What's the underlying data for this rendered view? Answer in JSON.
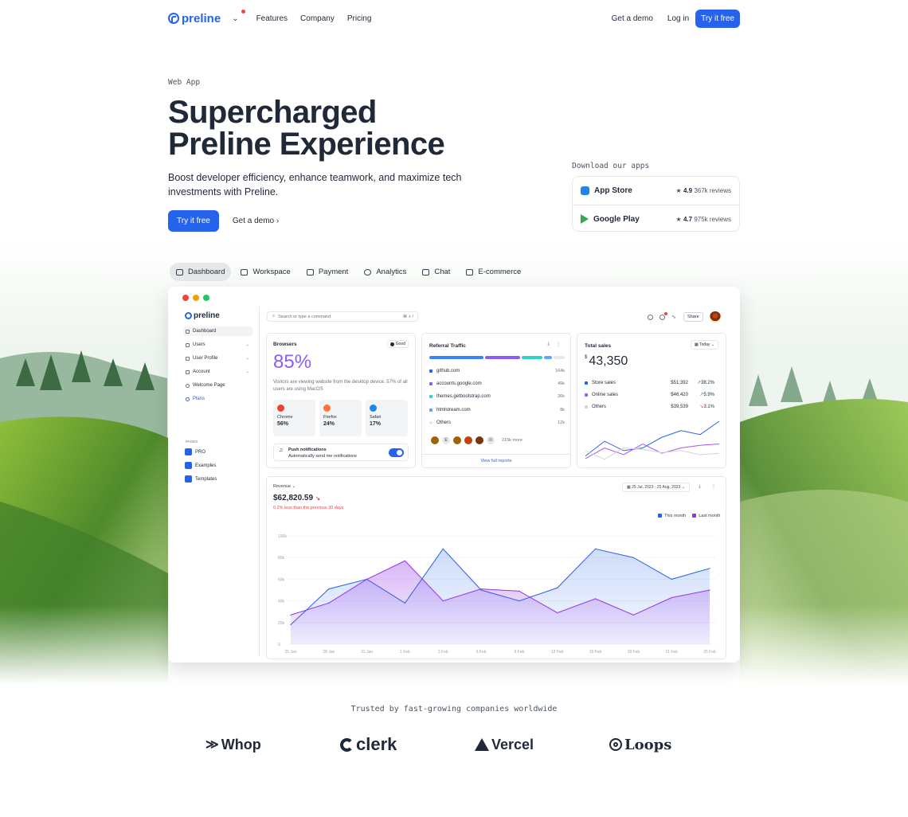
{
  "nav": {
    "brand": "preline",
    "links": [
      "Features",
      "Company",
      "Pricing"
    ],
    "get_demo": "Get a demo",
    "login": "Log in",
    "try_free": "Try it free"
  },
  "hero": {
    "eyebrow": "Web App",
    "title_line1": "Supercharged",
    "title_line2": "Preline Experience",
    "lead": "Boost developer efficiency, enhance teamwork, and maximize tech investments with Preline.",
    "cta_primary": "Try it free",
    "cta_secondary": "Get a demo"
  },
  "download": {
    "title": "Download our apps",
    "apps": [
      {
        "name": "App Store",
        "rating": "4.9",
        "reviews": "367k reviews"
      },
      {
        "name": "Google Play",
        "rating": "4.7",
        "reviews": "975k reviews"
      }
    ]
  },
  "tabs": [
    {
      "label": "Dashboard",
      "icon": "chart-icon",
      "active": true
    },
    {
      "label": "Workspace",
      "icon": "briefcase-icon"
    },
    {
      "label": "Payment",
      "icon": "receipt-icon"
    },
    {
      "label": "Analytics",
      "icon": "pie-icon"
    },
    {
      "label": "Chat",
      "icon": "chat-icon"
    },
    {
      "label": "E-commerce",
      "icon": "bag-icon"
    }
  ],
  "app": {
    "brand": "preline",
    "search_placeholder": "Search or type a command",
    "search_kbd": "⌘ + /",
    "share": "Share",
    "sidebar": [
      {
        "label": "Dashboard",
        "active": true,
        "chevron": false
      },
      {
        "label": "Users",
        "chevron": true
      },
      {
        "label": "User Profile",
        "chevron": true
      },
      {
        "label": "Account",
        "chevron": true
      },
      {
        "label": "Welcome Page",
        "chevron": false
      },
      {
        "label": "Plans",
        "chevron": false,
        "highlight": true
      }
    ],
    "pages_label": "PAGES",
    "pages": [
      "PRO",
      "Examples",
      "Templates"
    ],
    "browsers": {
      "title": "Browsers",
      "badge": "Good",
      "percent": "85%",
      "desc": "Visitors are viewing website from the desktop device. 57% of all users are using MacOS",
      "items": [
        {
          "name": "Chrome",
          "value": "56%",
          "color": "#ea4335"
        },
        {
          "name": "Firefox",
          "value": "24%",
          "color": "#ff7139"
        },
        {
          "name": "Safari",
          "value": "17%",
          "color": "#1e88e5"
        }
      ],
      "push_title": "Push notifications",
      "push_desc": "Automatically send me notifications"
    },
    "referral": {
      "title": "Referral Traffic",
      "bar_colors": [
        "#3b82f6",
        "#8b5cf6",
        "#2dd4bf",
        "#60a5fa",
        "#e5e7eb"
      ],
      "items": [
        {
          "name": "github.com",
          "value": "164k",
          "color": "#2563eb"
        },
        {
          "name": "accounts.google.com",
          "value": "49k",
          "color": "#8b5cf6"
        },
        {
          "name": "themes.getbootstrap.com",
          "value": "26k",
          "color": "#2dd4bf"
        },
        {
          "name": "htmlstream.com",
          "value": "8k",
          "color": "#60a5fa"
        },
        {
          "name": "Others",
          "value": "12k",
          "color": "#e5e7eb"
        }
      ],
      "face_letters": [
        "E",
        "O"
      ],
      "more": "215k more",
      "view_all": "View full reports"
    },
    "total_sales": {
      "title": "Total sales",
      "range": "Today",
      "currency": "$",
      "value": "43,350",
      "rows": [
        {
          "name": "Store sales",
          "amount": "$51,392",
          "change": "38.2%",
          "color": "#2563eb",
          "up": true
        },
        {
          "name": "Online sales",
          "amount": "$46,420",
          "change": "5.9%",
          "color": "#8b5cf6",
          "up": true
        },
        {
          "name": "Others",
          "amount": "$39,539",
          "change": "3.1%",
          "color": "#d1d5db",
          "up": false
        }
      ]
    },
    "revenue": {
      "label": "Revenue",
      "value": "$62,820.59",
      "note": "0.2% less than the previous 30 days",
      "date_range": "25 Jul, 2023 - 25 Aug, 2023",
      "legend": [
        "This month",
        "Last month"
      ]
    }
  },
  "chart_data": [
    {
      "type": "area",
      "title": "Revenue",
      "categories": [
        "25 Jan",
        "28 Jan",
        "31 Jan",
        "1 Feb",
        "3 Feb",
        "6 Feb",
        "9 Feb",
        "12 Feb",
        "15 Feb",
        "18 Feb",
        "21 Feb",
        "25 Feb"
      ],
      "y_ticks": [
        "100k",
        "80k",
        "60k",
        "40k",
        "20k",
        "0"
      ],
      "ylim": [
        0,
        100000
      ],
      "series": [
        {
          "name": "This month",
          "color": "#2563eb",
          "values": [
            18000,
            51000,
            60000,
            38000,
            88000,
            50000,
            40000,
            52000,
            88000,
            80000,
            60000,
            70000
          ]
        },
        {
          "name": "Last month",
          "color": "#9333ea",
          "values": [
            27000,
            38000,
            60000,
            77000,
            40000,
            51000,
            49000,
            29000,
            42000,
            27000,
            43000,
            50000
          ]
        }
      ]
    },
    {
      "type": "line",
      "title": "Total sales",
      "series": [
        {
          "name": "Store sales",
          "color": "#2563eb",
          "values": [
            10,
            32,
            18,
            22,
            38,
            48,
            42,
            62
          ]
        },
        {
          "name": "Online sales",
          "color": "#a855f7",
          "values": [
            6,
            22,
            12,
            28,
            14,
            22,
            26,
            28
          ]
        },
        {
          "name": "Others",
          "color": "#d1d5db",
          "values": [
            18,
            5,
            22,
            20,
            15,
            18,
            12,
            14
          ]
        }
      ]
    }
  ],
  "trusted": {
    "title": "Trusted by fast-growing companies worldwide",
    "logos": [
      "Whop",
      "clerk",
      "Vercel",
      "Loops"
    ]
  }
}
